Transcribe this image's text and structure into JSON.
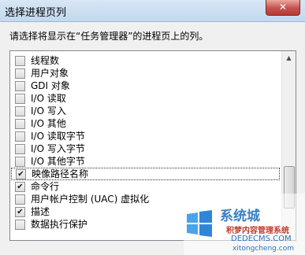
{
  "window": {
    "title": "选择进程页列",
    "close_label": "✕"
  },
  "instruction": "请选择将显示在“任务管理器”的进程页上的列。",
  "columns": [
    {
      "label": "线程数",
      "checked": false
    },
    {
      "label": "用户对象",
      "checked": false
    },
    {
      "label": "GDI 对象",
      "checked": false
    },
    {
      "label": "I/O 读取",
      "checked": false
    },
    {
      "label": "I/O 写入",
      "checked": false
    },
    {
      "label": "I/O 其他",
      "checked": false
    },
    {
      "label": "I/O 读取字节",
      "checked": false
    },
    {
      "label": "I/O 写入字节",
      "checked": false
    },
    {
      "label": "I/O 其他字节",
      "checked": false
    },
    {
      "label": "映像路径名称",
      "checked": true,
      "selected": true
    },
    {
      "label": "命令行",
      "checked": true
    },
    {
      "label": "用户帐户控制 (UAC) 虚拟化",
      "checked": false
    },
    {
      "label": "描述",
      "checked": true
    },
    {
      "label": "数据执行保护",
      "checked": false
    }
  ],
  "watermark": {
    "line1": "系统城",
    "line2": "积梦内容管理系统",
    "line3": "DEDECMS.COM",
    "line4": "xitongcheng.com"
  },
  "colors": {
    "accent": "#3a7fc4",
    "close": "#c75050"
  }
}
